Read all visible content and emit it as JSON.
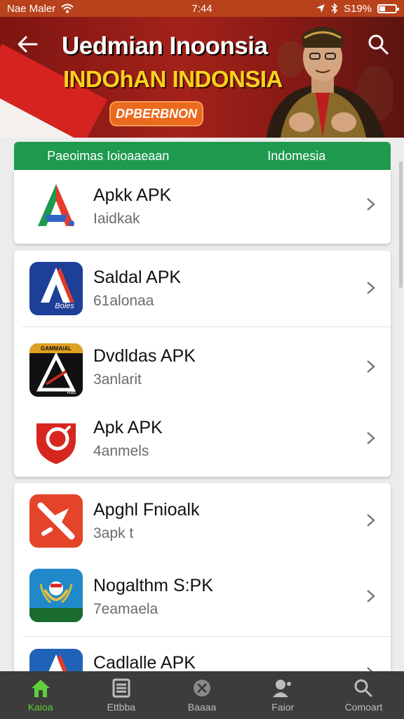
{
  "status_bar": {
    "carrier": "Nae Maler",
    "time": "7:44",
    "battery": "S19%"
  },
  "banner": {
    "title": "Uedmian Inoonsia",
    "subtitle": "INDOhAN INDONSIA",
    "button_label": "DPBERBNON"
  },
  "tabs": [
    "Paeoimas Ioioaaeaan",
    "Indomesia"
  ],
  "apps": [
    {
      "title": "Apkk APK",
      "subtitle": "Iaidkak"
    },
    {
      "title": "Saldal APK",
      "subtitle": "61alonaa"
    },
    {
      "title": "Dvdldas APK",
      "subtitle": "3anlarit"
    },
    {
      "title": "Apk APK",
      "subtitle": "4anmels"
    },
    {
      "title": "Apghl Fnioalk",
      "subtitle": "3apk t"
    },
    {
      "title": "Nogalthm S:PK",
      "subtitle": "7eamaela"
    },
    {
      "title": "Cadlalle APK",
      "subtitle": ""
    }
  ],
  "icon_labels": {
    "saldal": "Boles",
    "dvdldas_top": "GAMMAIAL",
    "dvdldas_bottom": "Ras"
  },
  "bottom_nav": [
    {
      "label": "Kaioa",
      "icon": "home-icon"
    },
    {
      "label": "Ettbba",
      "icon": "list-icon"
    },
    {
      "label": "Baaaa",
      "icon": "compass-icon"
    },
    {
      "label": "Faior",
      "icon": "user-icon"
    },
    {
      "label": "Comoart",
      "icon": "search-icon"
    }
  ],
  "colors": {
    "accent_green": "#1e9a4e",
    "nav_active": "#5fcf3a",
    "banner_red": "#a3221a",
    "banner_yellow": "#f7d21e"
  }
}
